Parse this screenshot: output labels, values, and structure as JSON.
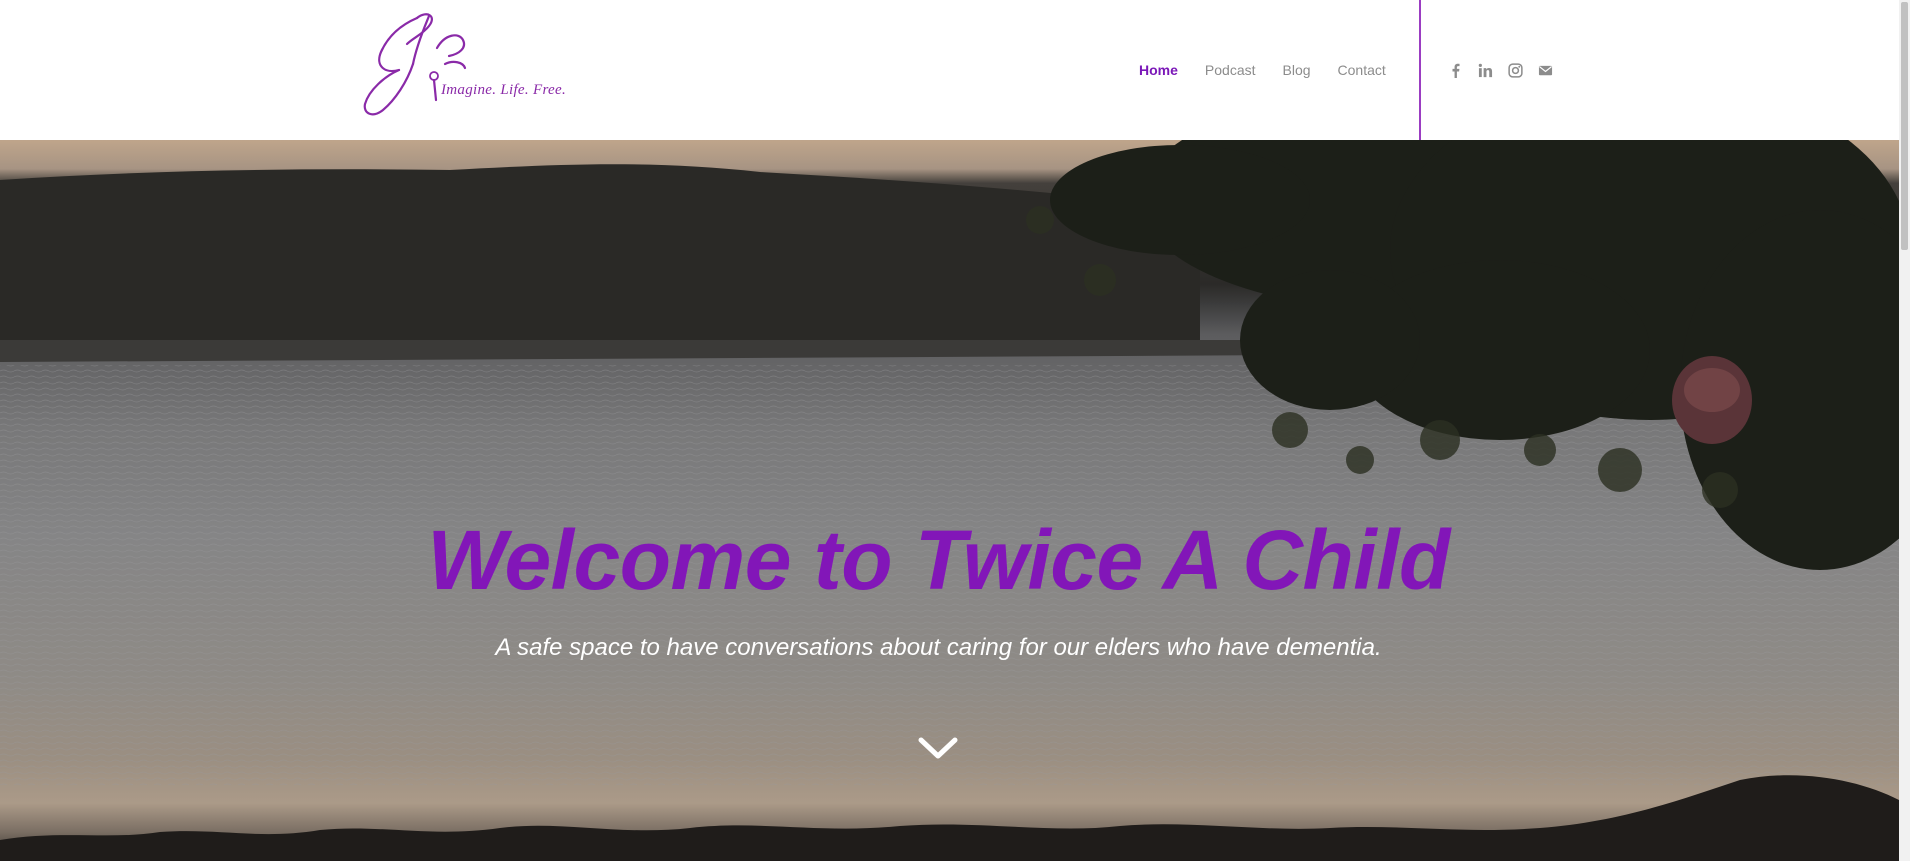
{
  "site": {
    "logo_tagline": "Imagine. Life. Free."
  },
  "nav": {
    "items": [
      {
        "label": "Home",
        "active": true
      },
      {
        "label": "Podcast",
        "active": false
      },
      {
        "label": "Blog",
        "active": false
      },
      {
        "label": "Contact",
        "active": false
      }
    ]
  },
  "socials": [
    "facebook-icon",
    "linkedin-icon",
    "instagram-icon",
    "mail-icon"
  ],
  "hero": {
    "title": "Welcome to Twice A Child",
    "subtitle": "A safe space to have conversations about caring for our elders who have dementia.",
    "scroll_icon": "chevron-down-icon"
  },
  "colors": {
    "accent": "#7b18b8",
    "nav_text": "#8c8c8c",
    "hero_title": "#8216b8",
    "hero_subtitle": "#ffffff"
  }
}
